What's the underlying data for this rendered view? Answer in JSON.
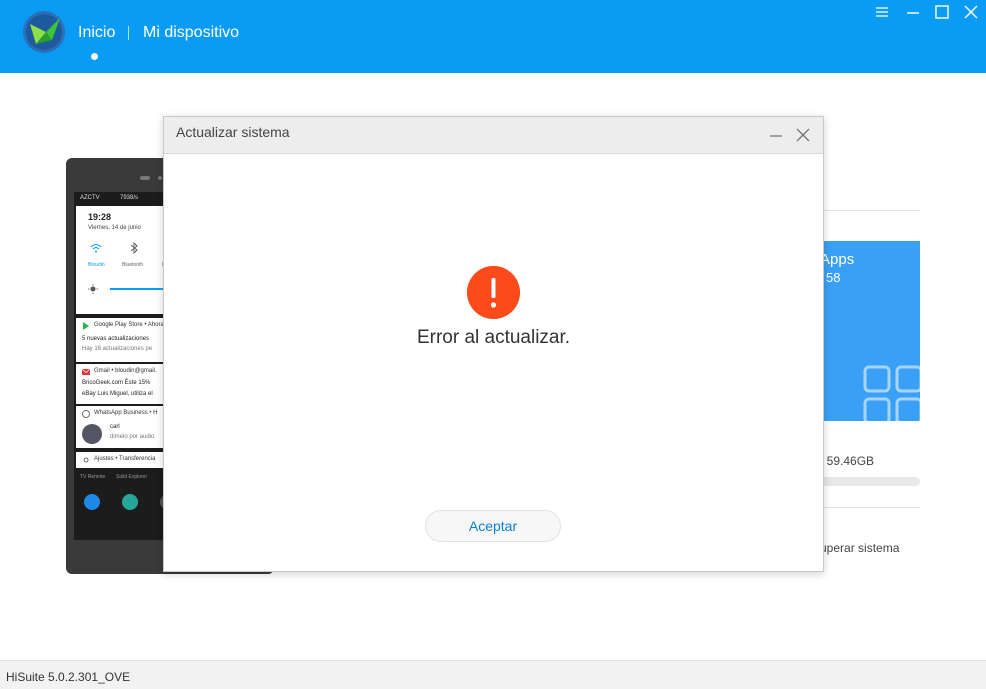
{
  "header": {
    "nav": [
      {
        "label": "Inicio"
      },
      {
        "label": "Mi dispositivo"
      }
    ],
    "icons": [
      "hisuite-logo",
      "menu-icon",
      "minimize-icon",
      "maximize-icon",
      "close-icon"
    ]
  },
  "phone": {
    "status_left": "AZCTV",
    "status_right": "7938/s",
    "time": "19:28",
    "date": "Viernes, 14 de junio",
    "quick_settings": [
      {
        "label": "Bloudin",
        "icon": "wifi-icon"
      },
      {
        "label": "Bluetooth",
        "icon": "bluetooth-icon"
      },
      {
        "label": "L",
        "icon": "location-icon"
      }
    ],
    "notifications": [
      {
        "header": "Google Play Store • Ahora",
        "lines": [
          "5 nuevas actualizaciones",
          "Hay 16 actualizaciones pe"
        ]
      },
      {
        "header": "Gmail • bloudin@gmail.",
        "lines": [
          "BricoGeek.com Éste 15%",
          "eBay Luis Miguel, utiliza el"
        ]
      },
      {
        "header": "WhatsApp Business • H",
        "lines": [
          "carl",
          "dimelo por audio"
        ]
      },
      {
        "header": "Ajustes • Transferencia",
        "lines": []
      }
    ],
    "dock_labels": [
      "TV Remote",
      "Solid Explorer"
    ]
  },
  "right_panel": {
    "apps_title": "Apps",
    "apps_count": "58",
    "storage_text": ": 59.46GB",
    "storage_fraction": 0.0,
    "recover_text": "uperar sistema"
  },
  "dialog": {
    "title": "Actualizar sistema",
    "message": "Error al actualizar.",
    "accept_label": "Aceptar",
    "error_color": "#fc4a1a"
  },
  "footer": {
    "version": "HiSuite 5.0.2.301_OVE"
  },
  "colors": {
    "accent": "#0a9cf5",
    "apps_card": "#3aa0f5"
  }
}
